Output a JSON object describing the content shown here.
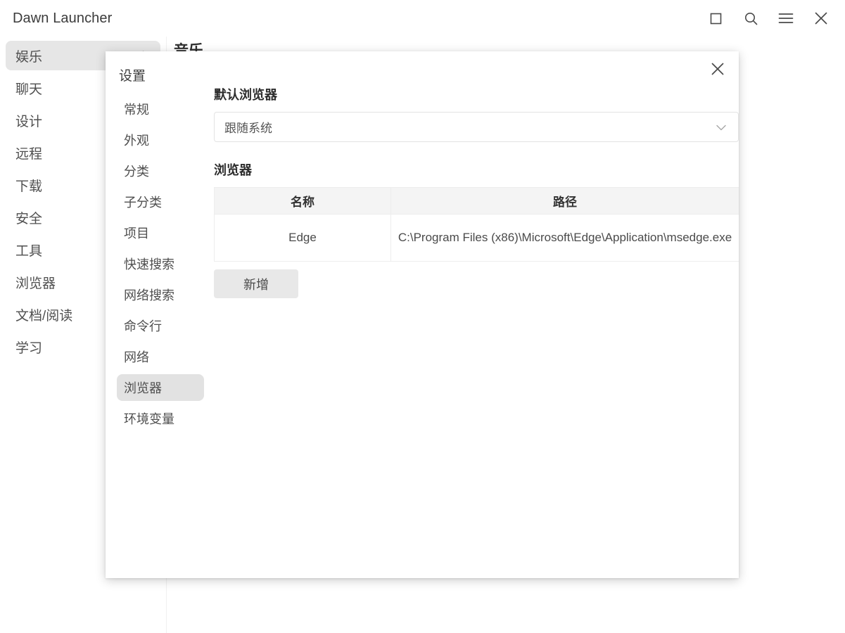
{
  "window": {
    "title": "Dawn Launcher",
    "controls": [
      {
        "name": "maximize-button",
        "icon": "maximize-icon"
      },
      {
        "name": "search-button",
        "icon": "search-icon"
      },
      {
        "name": "menu-button",
        "icon": "hamburger-menu-icon"
      },
      {
        "name": "close-button",
        "icon": "close-icon"
      }
    ]
  },
  "sidebar": {
    "items": [
      {
        "label": "娱乐",
        "active": true,
        "chevron": true
      },
      {
        "label": "聊天",
        "active": false,
        "chevron": false
      },
      {
        "label": "设计",
        "active": false,
        "chevron": false
      },
      {
        "label": "远程",
        "active": false,
        "chevron": false
      },
      {
        "label": "下载",
        "active": false,
        "chevron": false
      },
      {
        "label": "安全",
        "active": false,
        "chevron": false
      },
      {
        "label": "工具",
        "active": false,
        "chevron": false
      },
      {
        "label": "浏览器",
        "active": false,
        "chevron": false
      },
      {
        "label": "文档/阅读",
        "active": false,
        "chevron": false
      },
      {
        "label": "学习",
        "active": false,
        "chevron": false
      }
    ]
  },
  "content": {
    "title": "音乐"
  },
  "dialog": {
    "title": "设置",
    "close_icon": "close-icon",
    "nav": [
      {
        "label": "常规",
        "active": false
      },
      {
        "label": "外观",
        "active": false
      },
      {
        "label": "分类",
        "active": false
      },
      {
        "label": "子分类",
        "active": false
      },
      {
        "label": "项目",
        "active": false
      },
      {
        "label": "快速搜索",
        "active": false
      },
      {
        "label": "网络搜索",
        "active": false
      },
      {
        "label": "命令行",
        "active": false
      },
      {
        "label": "网络",
        "active": false
      },
      {
        "label": "浏览器",
        "active": true
      },
      {
        "label": "环境变量",
        "active": false
      }
    ],
    "default_browser": {
      "heading": "默认浏览器",
      "selected": "跟随系统",
      "caret_icon": "chevron-down-icon"
    },
    "browsers": {
      "heading": "浏览器",
      "columns": [
        "名称",
        "路径"
      ],
      "rows": [
        {
          "name": "Edge",
          "path": "C:\\Program Files (x86)\\Microsoft\\Edge\\Application\\msedge.exe"
        }
      ],
      "add_label": "新增"
    }
  },
  "colors": {
    "accent_highlight": "#e6e6e6",
    "nav_active": "#e2e2e2",
    "table_header": "#f4f4f4",
    "button_bg": "#e8e8e8",
    "text": "#4a4a4a"
  }
}
